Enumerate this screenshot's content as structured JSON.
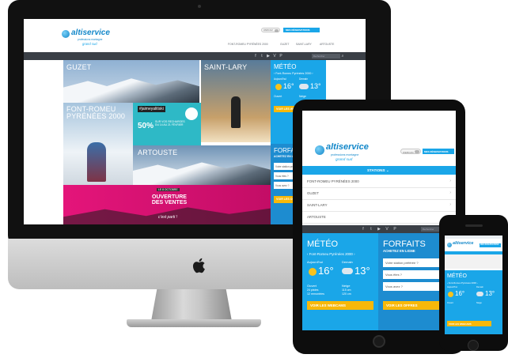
{
  "imac_site": {
    "brand": "altiservice",
    "tagline": "professions montagne",
    "partner": "grand sud",
    "header_buttons": {
      "toggle_label": "WEBCAM",
      "reserve": "MES RÉSERVATIONS"
    },
    "nav": [
      "FONT-ROMEU PYRÉNÉES 2000",
      "GUZET",
      "SAINT-LARY",
      "ARTOUSTE"
    ],
    "search_placeholder": "Rechercher",
    "stations": [
      "GUZET",
      "SAINT-LARY",
      "FONT-ROMEU PYRÉNÉES 2000",
      "ARTOUSTE"
    ],
    "promo": {
      "hashtag": "#jaimeyalitiski",
      "percent": "50%",
      "text": "SUR VOS RECHARGES DU 14 AU 21 FÉVRIER"
    },
    "ouverture": {
      "badge": "LE 8 OCTOBRE",
      "title": "OUVERTURE DES VENTES",
      "script": "c'est parti !"
    },
    "meteo": {
      "title": "MÉTÉO",
      "station": "Font-Romeu Pyrénées 2000",
      "today_label": "Aujourd'hui",
      "tomorrow_label": "Demain",
      "today_temp": "16°",
      "tomorrow_temp": "13°",
      "ouvert_label": "Ouvert",
      "neige_label": "Neige",
      "webcam_btn": "VOIR LES WEBCAMS"
    },
    "forfaits": {
      "title": "FORFAITS",
      "subtitle": "ACHETEZ EN LIGNE",
      "fields": [
        "Votre station préférée ?",
        "Vous êtes ?",
        "Vous avez ?"
      ],
      "btn": "VOIR LES OFFRES"
    }
  },
  "ipad_site": {
    "brand": "altiservice",
    "tagline": "professions montagne",
    "partner": "grand sud",
    "toggle_label": "WEBCAM",
    "reserve": "MES RÉSERVATIONS",
    "stations_bar": "STATIONS",
    "list": [
      "FONT-ROMEU PYRÉNÉES 2000",
      "GUZET",
      "SAINT-LARY",
      "ARTOUSTE"
    ],
    "search_placeholder": "Rechercher",
    "meteo": {
      "title": "MÉTÉO",
      "station": "Font-Romeu Pyrénées 2000",
      "today_label": "Aujourd'hui",
      "tomorrow_label": "Demain",
      "today_temp": "16°",
      "tomorrow_temp": "13°",
      "ouvert_label": "Ouvert",
      "ouvert_value": "24 pistes",
      "ouvert_value2": "12 remontées",
      "neige_label": "Neige",
      "neige_value": "115 cm",
      "neige_value2": "120 cm",
      "webcam_btn": "VOIR LES WEBCAMS"
    },
    "forfaits": {
      "title": "FORFAITS",
      "subtitle": "ACHETEZ EN LIGNE",
      "fields": [
        "Votre station préférée ?",
        "Vous êtes ?",
        "Vous avez ?"
      ],
      "btn": "VOIR LES OFFRES"
    }
  },
  "iphone_site": {
    "brand": "altiservice",
    "reserve": "MES RÉSERVATIONS",
    "meteo_title": "MÉTÉO",
    "station": "Font-Romeu Pyrénées 2000",
    "today_label": "Aujourd'hui",
    "tomorrow_label": "Demain",
    "today_temp": "16°",
    "tomorrow_temp": "13°",
    "ouvert_label": "Ouvert",
    "neige_label": "Neige",
    "webcam_btn": "VOIR LES WEBCAMS"
  },
  "colors": {
    "brand_blue": "#1aa6e8",
    "dark_blue": "#1d8cd0",
    "accent_yellow": "#f7b80a",
    "pink": "#e4157a",
    "nav_dark": "#3a3f46"
  }
}
